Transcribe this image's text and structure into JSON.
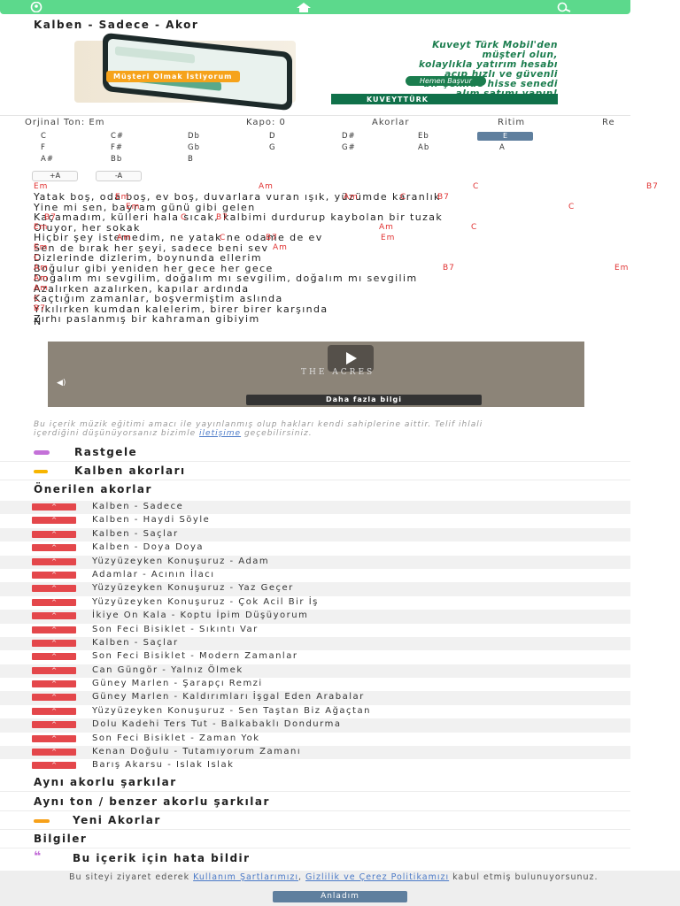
{
  "header": {
    "icons": [
      "user-icon",
      "home-icon",
      "search-icon"
    ],
    "bar_color": "#5cd98c"
  },
  "page_title": "Kalben - Sadece - Akor",
  "ad": {
    "tag": "Müşteri Olmak İstiyorum",
    "lines": [
      "Kuveyt Türk Mobil'den",
      "müşteri olun,",
      "kolaylıkla yatırım hesabı",
      "açıp hızlı ve güvenli",
      "bir şekilde hisse senedi",
      "alım satımı yapın!"
    ],
    "cta": "Hemen Başvur",
    "brand": "KUVEYTTÜRK"
  },
  "info": {
    "original_tone": "Orjinal Ton: Em",
    "capo": "Kapo: 0",
    "chords_tab": "Akorlar",
    "rhythm_tab": "Ritim",
    "more_tab": "Re"
  },
  "tones": {
    "row1": [
      "C",
      "C#",
      "Db",
      "D",
      "D#",
      "Eb",
      "E"
    ],
    "row2": [
      "F",
      "F#",
      "Gb",
      "G",
      "G#",
      "Ab",
      "A"
    ],
    "row3": [
      "A#",
      "Bb",
      "B"
    ],
    "selected": "E"
  },
  "zoom": {
    "plus": "+A",
    "minus": "-A"
  },
  "lyrics": [
    {
      "text": "Yatak boş, oda boş, ev boş, duvarlara vuran ışık, yüzümde karanlık",
      "chords": [
        [
          "Em",
          0
        ],
        [
          "Am",
          254
        ],
        [
          "C",
          496
        ],
        [
          "B7",
          692
        ]
      ]
    },
    {
      "text": "Yine mi sen, bayram günü gibi gelen",
      "chords": [
        [
          "Em",
          92
        ],
        [
          "Am",
          350
        ],
        [
          "C",
          414
        ],
        [
          "B7",
          456
        ]
      ]
    },
    {
      "text": "Kaçamadım, külleri hala sıcak, kalbimi durdurup kaybolan bir tuzak",
      "chords": [
        [
          "Em",
          104
        ],
        [
          "C",
          604
        ]
      ]
    },
    {
      "text": "Oluyor, her sokak",
      "chords": [
        [
          "B7",
          12
        ],
        [
          "C",
          166
        ],
        [
          "B7",
          206
        ]
      ]
    },
    {
      "text": "Hiçbir şey istemedim, ne yatak ne odame de ev",
      "chords": [
        [
          "Em",
          0
        ],
        [
          "Am",
          390
        ],
        [
          "C",
          494
        ]
      ]
    },
    {
      "text": "Sen de bırak her şeyi, sadece beni sev",
      "chords": [
        [
          "Am",
          94
        ],
        [
          "C",
          210
        ],
        [
          "B7",
          262
        ],
        [
          "Em",
          392
        ]
      ]
    },
    {
      "text": "Dizlerinde dizlerim, boynunda ellerim",
      "chords": [
        [
          "Em",
          0
        ],
        [
          "Am",
          270
        ]
      ]
    },
    {
      "text": "Boğulur gibi yeniden her gece her gece",
      "chords": [
        [
          "C",
          0
        ]
      ]
    },
    {
      "text": "Doğalım mı sevgilim, doğalım mı sevgilim, doğalım mı sevgilim",
      "chords": [
        [
          "Am",
          0
        ],
        [
          "B7",
          462
        ],
        [
          "Em",
          656
        ]
      ]
    },
    {
      "text": "Azalırken azalırken, kapılar ardında",
      "chords": [
        [
          "Am",
          0
        ]
      ]
    },
    {
      "text": "Kaçtığım zamanlar, boşvermiştim aslında",
      "chords": [
        [
          "Am",
          0
        ]
      ]
    },
    {
      "text": "Yıkılırken kumdan kalelerim, birer birer karşında",
      "chords": [
        [
          "C",
          0
        ]
      ]
    },
    {
      "text": "Zırhı paslanmış bir kahraman gibiyim",
      "chords": [
        [
          "B7",
          0
        ]
      ]
    },
    {
      "text": "N",
      "chords": []
    }
  ],
  "video": {
    "brand_text": "THE ACRES",
    "more_label": "Daha fazla bilgi"
  },
  "disclaimer": {
    "text_before": "Bu içerik müzik eğitimi amacı ile yayınlanmış olup hakları kendi sahiplerine aittir. Telif ihlali içerdiğini düşünüyorsanız bizimle ",
    "link": "iletişime",
    "text_after": " geçebilirsiniz."
  },
  "sections": {
    "random": "Rastgele",
    "kalben_chords": "Kalben akorları",
    "suggested": "Önerilen akorlar",
    "same_chords": "Aynı akorlu şarkılar",
    "same_tone": "Aynı ton / benzer akorlu şarkılar",
    "new_chords": "Yeni Akorlar",
    "info": "Bilgiler",
    "report": "Bu içerik için hata bildir"
  },
  "colors": {
    "random_dot": "#c471d8",
    "kalben_dot": "#f7b500",
    "new_dot": "#f7a11a",
    "report_icon": "#c471d8",
    "badge": "#e4474b",
    "button": "#5f7f9e"
  },
  "suggested_songs": [
    "Kalben - Sadece",
    "Kalben - Haydi Söyle",
    "Kalben - Saçlar",
    "Kalben - Doya Doya",
    "Yüzyüzeyken Konuşuruz - Adam",
    "Adamlar - Acının İlacı",
    "Yüzyüzeyken Konuşuruz - Yaz Geçer",
    "Yüzyüzeyken Konuşuruz - Çok Acil Bir İş",
    "İkiye On Kala - Koptu İpim Düşüyorum",
    "Son Feci Bisiklet - Sıkıntı Var",
    "Kalben - Saçlar",
    "Son Feci Bisiklet - Modern Zamanlar",
    "Can Güngör - Yalnız Ölmek",
    "Güney Marlen - Şarapçı Remzi",
    "Güney Marlen - Kaldırımları İşgal Eden Arabalar",
    "Yüzyüzeyken Konuşuruz - Sen Taştan Biz Ağaçtan",
    "Dolu Kadehi Ters Tut - Balkabaklı Dondurma",
    "Son Feci Bisiklet - Zaman Yok",
    "Kenan Doğulu - Tutamıyorum Zamanı",
    "Barış Akarsu - Islak Islak"
  ],
  "badge_label": "^",
  "cookie": {
    "before": "Bu siteyi ziyaret ederek ",
    "link1": "Kullanım Şartlarımızı",
    "mid": ", ",
    "link2": "Gizlilik ve Çerez Politikamızı",
    "after": " kabul etmiş bulunuyorsunuz.",
    "button": "Anladım"
  }
}
